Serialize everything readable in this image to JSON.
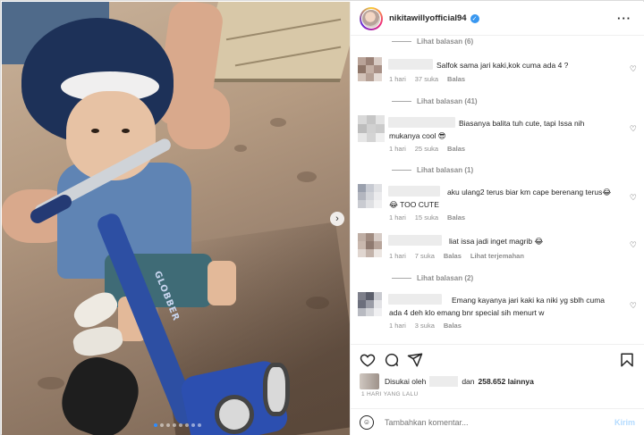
{
  "post": {
    "username": "nikitawillyofficial94",
    "verified_icon": "verified-badge-icon",
    "more_icon": "more-horizontal-icon",
    "photo_alt_icon": "photo-carousel",
    "carousel": {
      "total_dots": 8,
      "active_index": 0,
      "next_icon": "chevron-right-icon",
      "next_glyph": "›"
    }
  },
  "comments": [
    {
      "replies_label": "Lihat balasan (6)"
    },
    {
      "text": "Salfok sama jari kaki,kok cuma ada 4 ?",
      "time": "1 hari",
      "likes": "37 suka",
      "reply": "Balas",
      "translate": ""
    },
    {
      "replies_label": "Lihat balasan (41)"
    },
    {
      "text": "Biasanya balita tuh cute, tapi Issa nih",
      "text2": "mukanya cool 😎",
      "time": "1 hari",
      "likes": "25 suka",
      "reply": "Balas",
      "translate": ""
    },
    {
      "replies_label": "Lihat balasan (1)"
    },
    {
      "text": "aku ulang2 terus biar km cape berenang terus😂",
      "text2": "😂 TOO CUTE",
      "time": "1 hari",
      "likes": "15 suka",
      "reply": "Balas",
      "translate": ""
    },
    {
      "text": "liat issa jadi inget magrib 😂",
      "time": "1 hari",
      "likes": "7 suka",
      "reply": "Balas",
      "translate": "Lihat terjemahan"
    },
    {
      "replies_label": "Lihat balasan (2)"
    },
    {
      "text": "Emang kayanya jari kaki ka niki yg sblh cuma",
      "text2": "ada 4 deh klo emang bnr special sih menurt w",
      "time": "1 hari",
      "likes": "3 suka",
      "reply": "Balas",
      "translate": ""
    }
  ],
  "actions": {
    "like_icon": "heart-icon",
    "comment_icon": "comment-icon",
    "share_icon": "send-icon",
    "save_icon": "bookmark-icon"
  },
  "likes": {
    "prefix": "Disukai oleh",
    "middle": "dan",
    "count": "258.652 lainnya"
  },
  "time_ago": "1 HARI YANG LALU",
  "add_comment": {
    "emoji_icon": "emoji-icon",
    "placeholder": "Tambahkan komentar...",
    "post_label": "Kirim"
  },
  "colors": {
    "verified": "#3897f0",
    "muted_text": "#8e8e8e",
    "post_disabled": "#b3dbff",
    "carousel_active": "#2f8dff"
  }
}
